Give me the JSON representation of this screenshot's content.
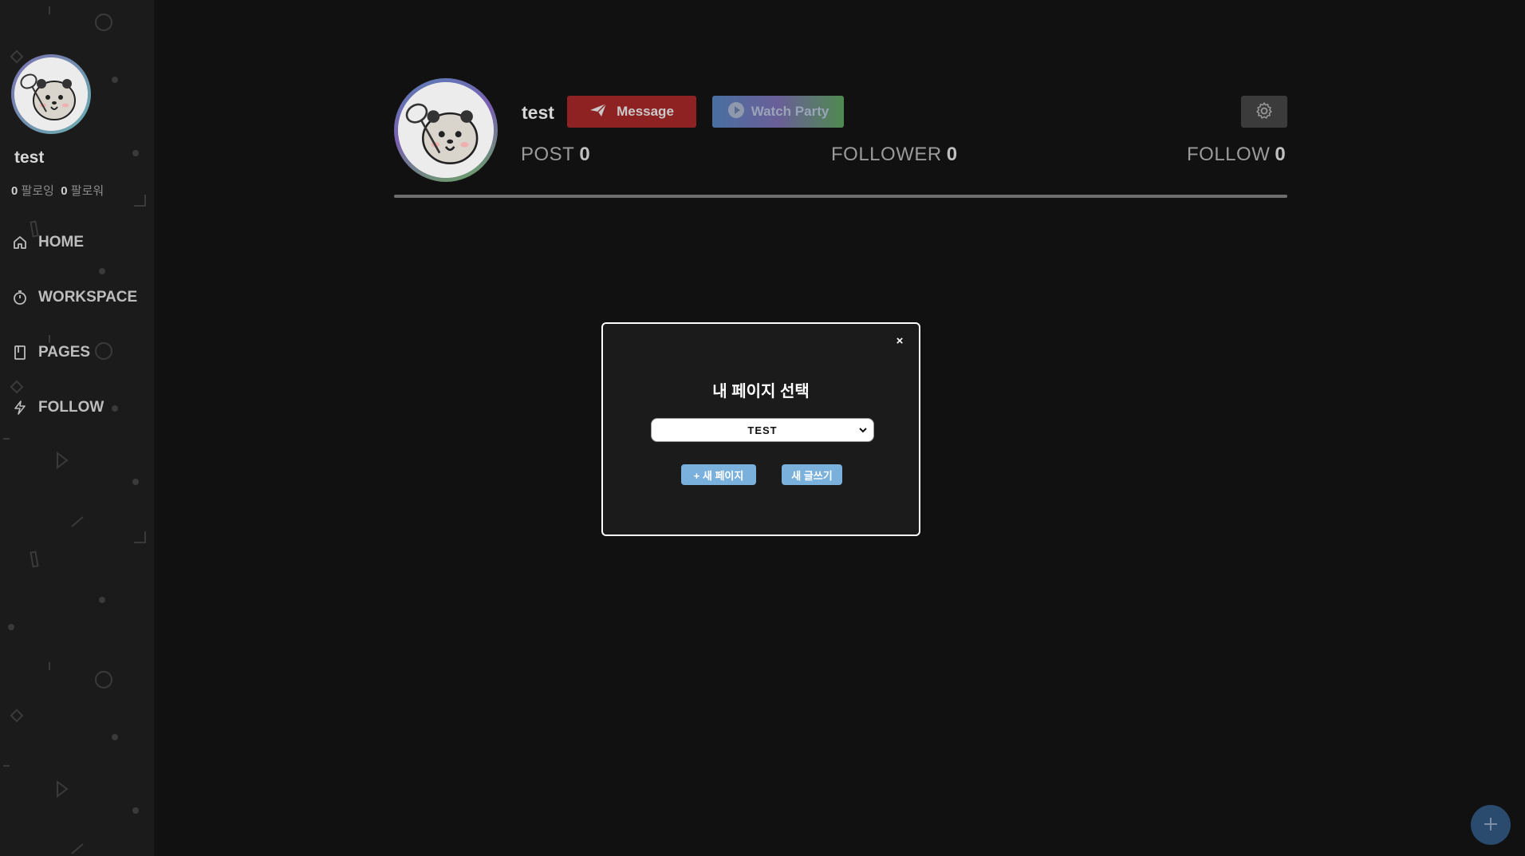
{
  "sidebar": {
    "username": "test",
    "following_count": "0",
    "following_label": "팔로잉",
    "follower_count": "0",
    "follower_label": "팔로워",
    "nav": [
      {
        "label": "HOME",
        "icon": "home-icon"
      },
      {
        "label": "WORKSPACE",
        "icon": "stopwatch-icon"
      },
      {
        "label": "PAGES",
        "icon": "book-icon"
      },
      {
        "label": "FOLLOW",
        "icon": "lightning-icon"
      }
    ]
  },
  "profile": {
    "name": "test",
    "message_label": "Message",
    "watch_party_label": "Watch Party",
    "stats": {
      "post_label": "POST",
      "post_value": "0",
      "follower_label": "FOLLOWER",
      "follower_value": "0",
      "follow_label": "FOLLOW",
      "follow_value": "0"
    }
  },
  "modal": {
    "close_label": "×",
    "title": "내 페이지 선택",
    "selected_page": "TEST",
    "new_page_label": "+ 새 페이지",
    "new_post_label": "새 글쓰기"
  },
  "colors": {
    "background": "#111111",
    "sidebar": "#1b1b1b",
    "message_button": "#8e2222",
    "modal_button": "#7ab0dc",
    "fab": "#2a4a6e"
  }
}
